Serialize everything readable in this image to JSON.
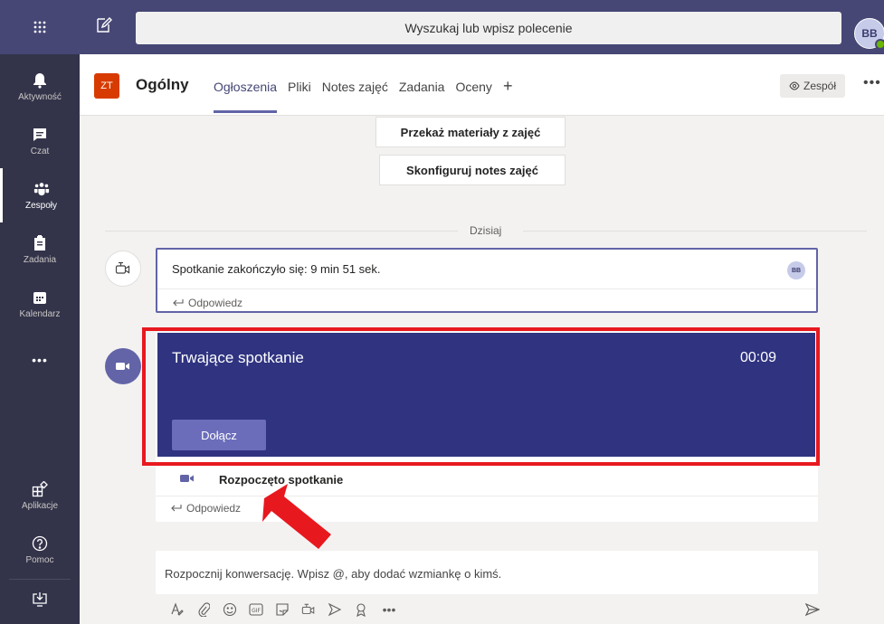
{
  "topbar": {
    "search_placeholder": "Wyszukaj lub wpisz polecenie",
    "avatar_initials": "BB"
  },
  "rail": {
    "items": [
      {
        "label": "Aktywność",
        "icon": "bell-icon"
      },
      {
        "label": "Czat",
        "icon": "chat-icon"
      },
      {
        "label": "Zespoły",
        "icon": "teams-icon"
      },
      {
        "label": "Zadania",
        "icon": "assignments-icon"
      },
      {
        "label": "Kalendarz",
        "icon": "calendar-icon"
      },
      {
        "label": "Aplikacje",
        "icon": "apps-icon"
      },
      {
        "label": "Pomoc",
        "icon": "help-icon"
      }
    ],
    "more_label": "•••"
  },
  "channel": {
    "team_tile": "ZT",
    "name": "Ogólny",
    "tabs": [
      "Ogłoszenia",
      "Pliki",
      "Notes zajęć",
      "Zadania",
      "Oceny"
    ],
    "add_tab": "+",
    "team_button": "Zespół",
    "more": "•••"
  },
  "content": {
    "btn_materials": "Przekaż materiały z zajęć",
    "btn_notes": "Skonfiguruj notes zajęć",
    "day_label": "Dzisiaj",
    "msg1": {
      "text": "Spotkanie zakończyło się: 9 min 51 sek.",
      "avatar": "BB",
      "reply": "Odpowiedz"
    },
    "meeting": {
      "title": "Trwające spotkanie",
      "time": "00:09",
      "join": "Dołącz"
    },
    "msg2": {
      "text": "Rozpoczęto spotkanie",
      "reply": "Odpowiedz"
    },
    "composer_placeholder": "Rozpocznij konwersację. Wpisz @, aby dodać wzmiankę o kimś."
  },
  "colors": {
    "topbar": "#464775",
    "rail": "#33344a",
    "accent": "#6264a7",
    "meeting_bg": "#2f3380",
    "highlight_red": "#e8181f"
  }
}
